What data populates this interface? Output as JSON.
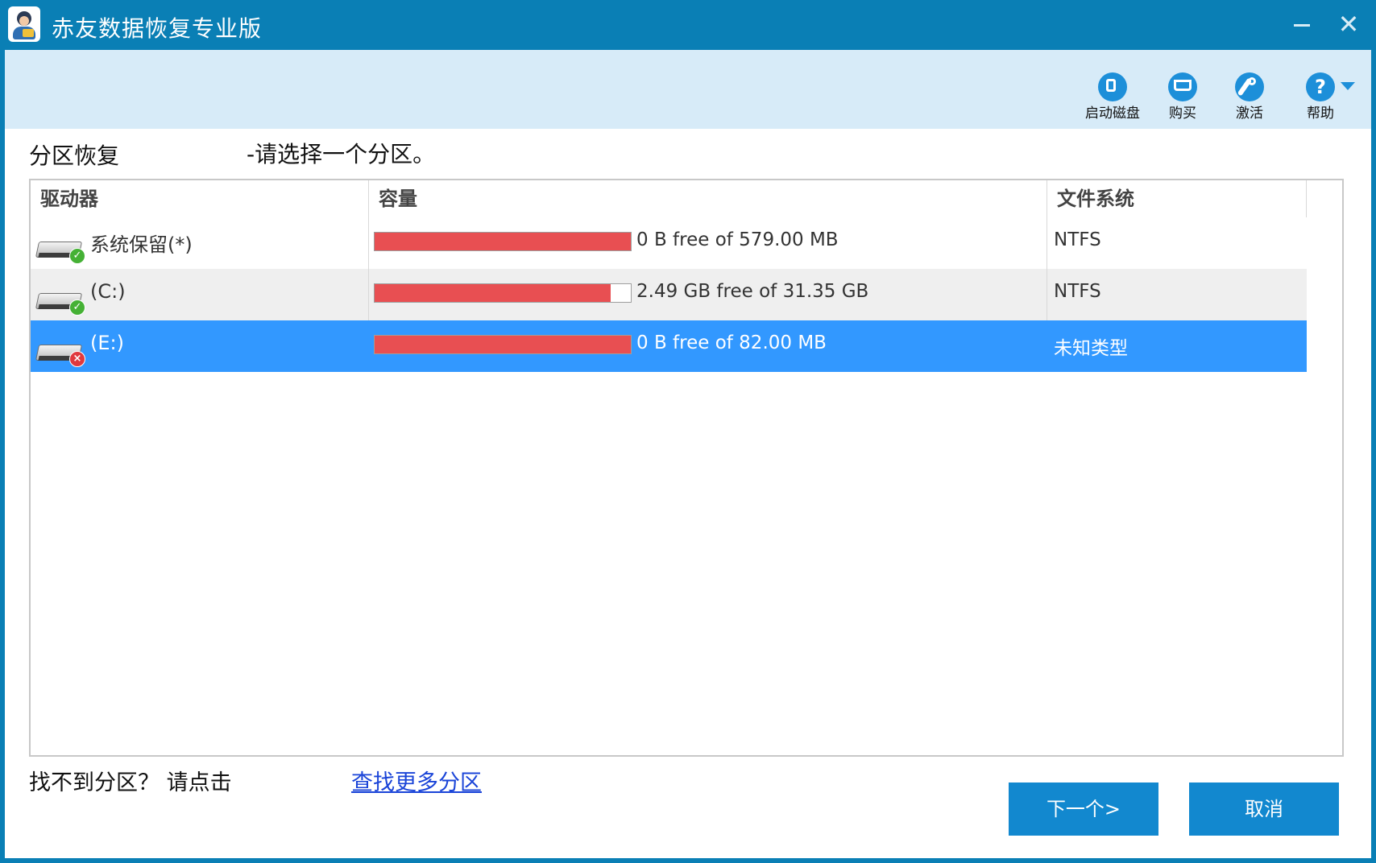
{
  "window": {
    "title": "赤友数据恢复专业版",
    "minimize_label": "–",
    "close_label": "✕"
  },
  "toolbar": {
    "items": [
      {
        "label": "启动磁盘",
        "icon": "boot-disk-icon"
      },
      {
        "label": "购买",
        "icon": "cart-icon"
      },
      {
        "label": "激活",
        "icon": "key-icon"
      },
      {
        "label": "帮助",
        "icon": "help-icon",
        "glyph": "?"
      }
    ]
  },
  "main": {
    "section_title": "分区恢复",
    "instruction": "-请选择一个分区。",
    "table": {
      "columns": [
        "驱动器",
        "容量",
        "文件系统"
      ],
      "rows": [
        {
          "drive": "系统保留(*)",
          "capacity": "0 B free of 579.00 MB",
          "used_fraction": 1.0,
          "filesystem": "NTFS",
          "status": "ok"
        },
        {
          "drive": "(C:)",
          "capacity": "2.49 GB free of 31.35 GB",
          "used_fraction": 0.92,
          "filesystem": "NTFS",
          "status": "ok"
        },
        {
          "drive": "(E:)",
          "capacity": "0 B free of 82.00 MB",
          "used_fraction": 1.0,
          "filesystem": "未知类型",
          "status": "error",
          "selected": true
        }
      ]
    }
  },
  "footer": {
    "prompt": "找不到分区？ 请点击",
    "link": "查找更多分区",
    "next_button": "下一个>",
    "cancel_button": "取消"
  },
  "colors": {
    "titlebar": "#0a7fb5",
    "toolbar": "#d7ebf8",
    "selection": "#3298ff",
    "capacity_used": "#e84f52",
    "button": "#1288cf",
    "link": "#1a44d8"
  }
}
